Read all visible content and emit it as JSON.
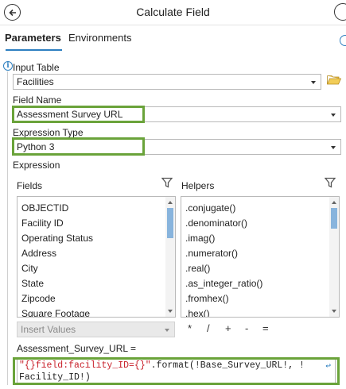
{
  "window": {
    "title": "Calculate Field"
  },
  "tabs": [
    {
      "label": "Parameters",
      "active": true
    },
    {
      "label": "Environments",
      "active": false
    }
  ],
  "input_table": {
    "label": "Input Table",
    "value": "Facilities"
  },
  "field_name": {
    "label": "Field Name",
    "value": "Assessment Survey URL"
  },
  "expression_type": {
    "label": "Expression Type",
    "value": "Python 3"
  },
  "expression": {
    "label": "Expression",
    "fields_label": "Fields",
    "helpers_label": "Helpers",
    "fields": [
      "OBJECTID",
      "Facility ID",
      "Operating Status",
      "Address",
      "City",
      "State",
      "Zipcode",
      "Square Footage"
    ],
    "helpers": [
      ".conjugate()",
      ".denominator()",
      ".imag()",
      ".numerator()",
      ".real()",
      ".as_integer_ratio()",
      ".fromhex()",
      ".hex()"
    ],
    "insert_values": "Insert Values",
    "operators": [
      "*",
      "/",
      "+",
      "-",
      "="
    ],
    "target_label": "Assessment_Survey_URL =",
    "code_line1_string": "\"{}field:facility_ID={}\"",
    "code_line1_rest": ".format(!Base_Survey_URL!, !",
    "code_line2": "Facility_ID!)"
  },
  "colors": {
    "highlight": "#6aa33a",
    "accent": "#2d7fc0",
    "string": "#c8202a"
  },
  "icons": [
    "back-arrow-icon",
    "info-icon",
    "folder-open-icon",
    "filter-funnel-icon",
    "chevron-down-icon",
    "word-wrap-icon"
  ]
}
